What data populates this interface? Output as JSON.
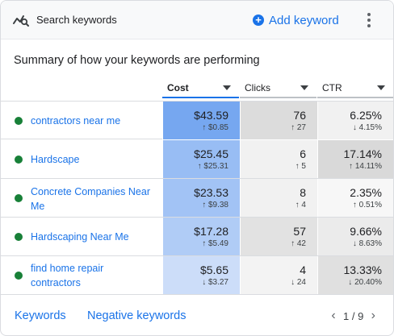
{
  "header": {
    "title": "Search keywords",
    "icon": "keyword-insights-icon",
    "add_label": "Add keyword",
    "more_icon": "more-vert-icon"
  },
  "summary_title": "Summary of how your keywords are performing",
  "columns": [
    {
      "label": "Cost"
    },
    {
      "label": "Clicks"
    },
    {
      "label": "CTR"
    }
  ],
  "rows": [
    {
      "keyword": "contractors near me",
      "status": "enabled",
      "cost": "$43.59",
      "cost_delta": "↑ $0.85",
      "cost_shade": "#76a7f0",
      "clicks": "76",
      "clicks_delta": "↑ 27",
      "clicks_shade": "#dcdcdc",
      "ctr": "6.25%",
      "ctr_delta": "↓ 4.15%",
      "ctr_shade": "#f1f1f1"
    },
    {
      "keyword": "Hardscape",
      "status": "enabled",
      "cost": "$25.45",
      "cost_delta": "↑ $25.31",
      "cost_shade": "#98bdf4",
      "clicks": "6",
      "clicks_delta": "↑ 5",
      "clicks_shade": "#f1f1f1",
      "ctr": "17.14%",
      "ctr_delta": "↑ 14.11%",
      "ctr_shade": "#d9d9d9"
    },
    {
      "keyword": "Concrete Companies Near Me",
      "status": "enabled",
      "cost": "$23.53",
      "cost_delta": "↑ $9.38",
      "cost_shade": "#a2c3f5",
      "clicks": "8",
      "clicks_delta": "↑ 4",
      "clicks_shade": "#f1f1f1",
      "ctr": "2.35%",
      "ctr_delta": "↑ 0.51%",
      "ctr_shade": "#f7f7f7"
    },
    {
      "keyword": "Hardscaping Near Me",
      "status": "enabled",
      "cost": "$17.28",
      "cost_delta": "↑ $5.49",
      "cost_shade": "#b0ccf6",
      "clicks": "57",
      "clicks_delta": "↑ 42",
      "clicks_shade": "#e2e2e2",
      "ctr": "9.66%",
      "ctr_delta": "↓ 8.63%",
      "ctr_shade": "#ebebeb"
    },
    {
      "keyword": "find home repair contractors",
      "status": "enabled",
      "cost": "$5.65",
      "cost_delta": "↓ $3.27",
      "cost_shade": "#ccddf9",
      "clicks": "4",
      "clicks_delta": "↓ 24",
      "clicks_shade": "#f3f3f3",
      "ctr": "13.33%",
      "ctr_delta": "↓ 20.40%",
      "ctr_shade": "#e0e0e0"
    }
  ],
  "footer": {
    "keywords_link": "Keywords",
    "negative_link": "Negative keywords",
    "pagination": "1 / 9",
    "prev_icon": "chevron-left-icon",
    "next_icon": "chevron-right-icon"
  },
  "colors": {
    "accent": "#1a73e8",
    "enabled_status": "#188038"
  }
}
